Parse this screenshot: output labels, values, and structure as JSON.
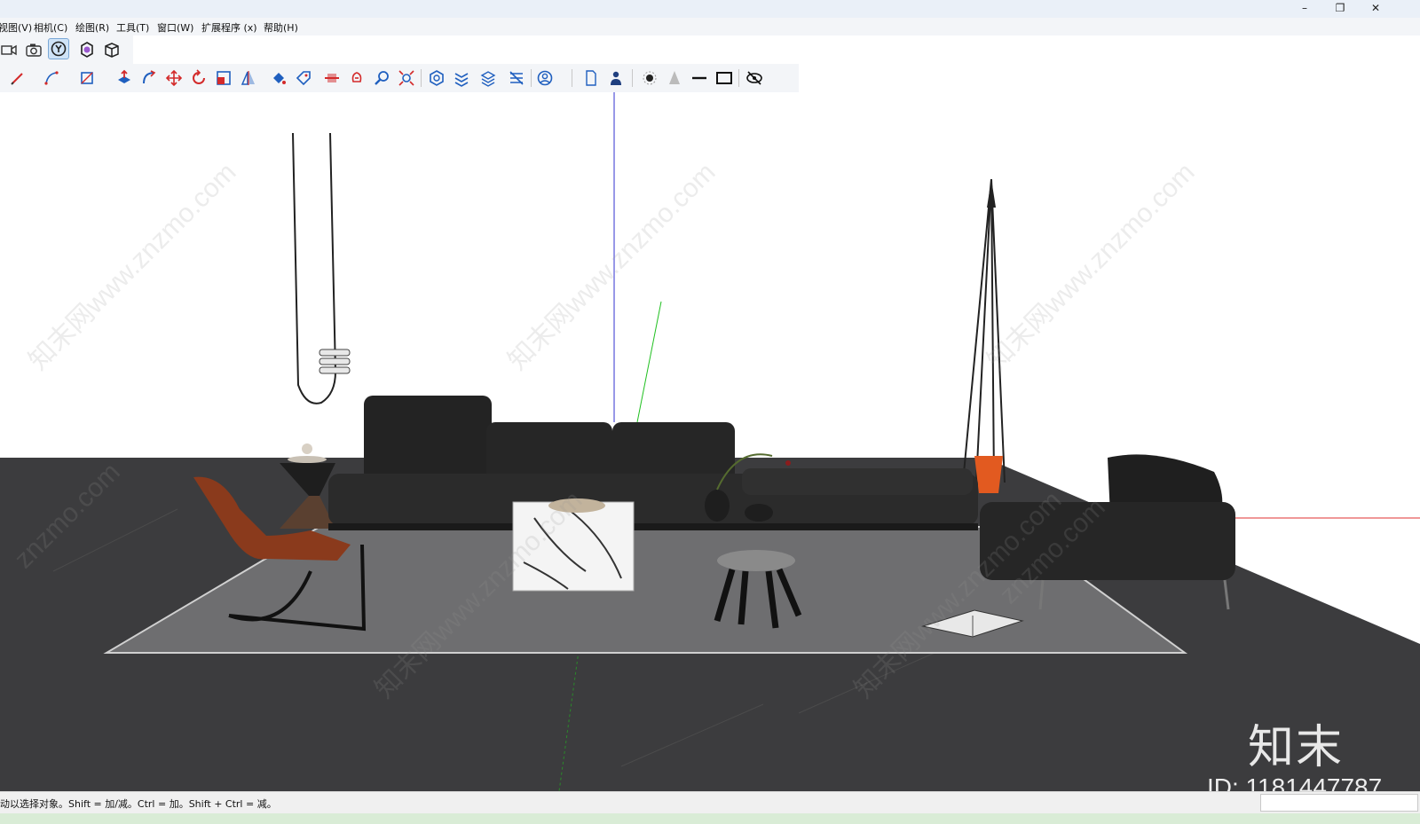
{
  "window": {
    "controls": {
      "minimize": "–",
      "restore": "❐",
      "close": "✕"
    }
  },
  "menubar": {
    "items": [
      {
        "label": "视图(V)"
      },
      {
        "label": "相机(C)"
      },
      {
        "label": "绘图(R)"
      },
      {
        "label": "工具(T)"
      },
      {
        "label": "窗口(W)"
      },
      {
        "label": "扩展程序 (x)"
      },
      {
        "label": "帮助(H)"
      }
    ]
  },
  "toolbar_top": {
    "buttons": [
      "video-camera-icon",
      "camera-icon",
      "select-tool-icon",
      "component-icon",
      "box-icon"
    ],
    "active": "select-tool-icon"
  },
  "toolbar_main": {
    "buttons": [
      "pencil-icon",
      "arc-icon",
      "rectangle-icon",
      "push-pull-icon",
      "follow-me-icon",
      "move-icon",
      "rotate-icon",
      "scale-icon",
      "flip-icon",
      "paint-bucket-icon",
      "tag-icon",
      "section-plane-icon",
      "walk-icon",
      "zoom-icon",
      "zoom-extents-icon",
      "sandbox-icon",
      "stamp-icon",
      "drape-icon",
      "flip-edge-icon",
      "user-icon",
      "new-file-icon",
      "person-icon",
      "dot-icon",
      "cone-icon",
      "line-icon",
      "rectangle-outline-icon",
      "hide-icon"
    ],
    "accent_red": "#d32a2a",
    "accent_blue": "#1f5fbf"
  },
  "viewport": {
    "floor_color": "#3c3c3e",
    "rug_color": "#6e6e70",
    "sofa_color": "#232323",
    "chair_color": "#8a3a1c"
  },
  "watermarks": {
    "text_cn": "知末网www.znzmo.com",
    "text_short": "znzmo.com",
    "brand": "知末",
    "id": "ID: 1181447787"
  },
  "statusbar": {
    "hint": "动以选择对象。Shift = 加/减。Ctrl = 加。Shift + Ctrl = 减。"
  }
}
